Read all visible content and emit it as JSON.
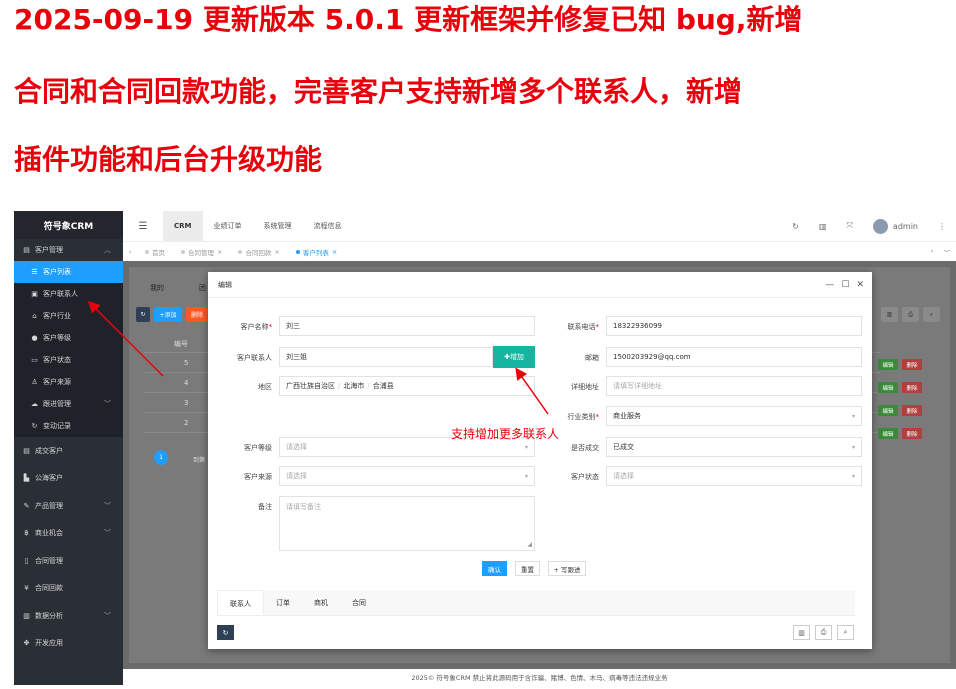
{
  "headline": {
    "line1": "2025-09-19 更新版本 5.0.1 更新框架并修复已知 bug,新增",
    "line2": "合同和合同回款功能，完善客户支持新增多个联系人，新增",
    "line3": "插件功能和后台升级功能"
  },
  "colors": {
    "headline": "#e8000b",
    "sidebar": "#2a2e35",
    "accent": "#1e9fff",
    "add_button": "#16b59f"
  },
  "sidebar": {
    "logo": "符号象CRM",
    "items": [
      {
        "label": "客户管理",
        "icon": "address-card-icon"
      },
      {
        "label": "客户列表",
        "icon": "list-icon"
      },
      {
        "label": "客户联系人",
        "icon": "contact-icon"
      },
      {
        "label": "客户行业",
        "icon": "industry-icon"
      },
      {
        "label": "客户等级",
        "icon": "level-icon"
      },
      {
        "label": "客户状态",
        "icon": "status-icon"
      },
      {
        "label": "客户来源",
        "icon": "source-icon"
      },
      {
        "label": "跟进管理",
        "icon": "follow-icon"
      },
      {
        "label": "变动记录",
        "icon": "history-icon"
      },
      {
        "label": "成交客户",
        "icon": "deal-icon"
      },
      {
        "label": "公海客户",
        "icon": "pool-icon"
      },
      {
        "label": "产品管理",
        "icon": "product-icon"
      },
      {
        "label": "商业机会",
        "icon": "opportunity-icon"
      },
      {
        "label": "合同管理",
        "icon": "contract-icon"
      },
      {
        "label": "合同回款",
        "icon": "payment-icon"
      },
      {
        "label": "数据分析",
        "icon": "chart-icon"
      },
      {
        "label": "开发应用",
        "icon": "app-icon"
      }
    ]
  },
  "topbar": {
    "nav": [
      "CRM",
      "业绩订单",
      "系统管理",
      "流程信息"
    ],
    "user": "admin"
  },
  "tabs": [
    "首页",
    "合同管理",
    "合同回款",
    "客户列表"
  ],
  "background": {
    "tab1": "我的",
    "tab2": "团",
    "add": "+添加",
    "delete": "删除",
    "col_number": "编号",
    "rows": [
      "5",
      "4",
      "3",
      "2"
    ],
    "page_current": "1",
    "page_label": "到第",
    "edit": "编辑",
    "remove": "删除"
  },
  "modal": {
    "title": "编辑",
    "fields": {
      "customer_name": {
        "label": "客户名称",
        "value": "刘三"
      },
      "phone": {
        "label": "联系电话",
        "value": "18322936099"
      },
      "contact": {
        "label": "客户联系人",
        "value": "刘三姐"
      },
      "add_button": "增加",
      "email": {
        "label": "邮箱",
        "value": "1500203929@qq.com"
      },
      "region": {
        "label": "地区",
        "province": "广西壮族自治区",
        "city": "北海市",
        "district": "合浦县"
      },
      "address": {
        "label": "详细地址",
        "placeholder": "请填写详细地址"
      },
      "industry": {
        "label": "行业类别",
        "value": "商业服务"
      },
      "level": {
        "label": "客户等级",
        "placeholder": "请选择"
      },
      "deal": {
        "label": "是否成交",
        "value": "已成交"
      },
      "source": {
        "label": "客户来源",
        "placeholder": "请选择"
      },
      "status": {
        "label": "客户状态",
        "placeholder": "请选择"
      },
      "remark": {
        "label": "备注",
        "placeholder": "请填写备注"
      }
    },
    "buttons": {
      "confirm": "确认",
      "reset": "重置",
      "followup": "写跟进"
    },
    "tabs": [
      "联系人",
      "订单",
      "商机",
      "合同"
    ]
  },
  "annotation": "支持增加更多联系人",
  "footer": "2025© 符号象CRM 禁止将此源码用于含诈骗、赌博、色情、木马、病毒等违法违规业务"
}
